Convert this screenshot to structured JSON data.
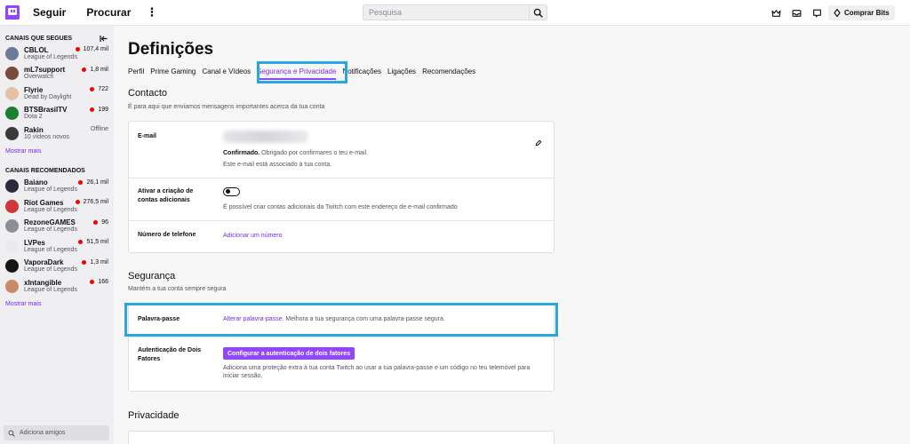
{
  "topnav": {
    "follow": "Seguir",
    "browse": "Procurar",
    "more": "⋮",
    "search_placeholder": "Pesquisa",
    "bits": "Comprar Bits"
  },
  "sidebar": {
    "followed_title": "CANAIS QUE SEGUES",
    "followed": [
      {
        "name": "CBLOL",
        "game": "League of Legends",
        "viewers": "107,4 mil",
        "live": true,
        "color": "#6b7a99"
      },
      {
        "name": "mL7support",
        "game": "Overwatch",
        "viewers": "1,8 mil",
        "live": true,
        "color": "#7a4a3a"
      },
      {
        "name": "Flyrie",
        "game": "Dead by Daylight",
        "viewers": "722",
        "live": true,
        "color": "#e4c2a8"
      },
      {
        "name": "BTSBrasilTV",
        "game": "Dota 2",
        "viewers": "199",
        "live": true,
        "color": "#1a7f2e"
      },
      {
        "name": "Rakin",
        "game": "10 vídeos novos",
        "viewers": "Offline",
        "live": false,
        "color": "#3a3a3a"
      }
    ],
    "show_more": "Mostrar mais",
    "recommended_title": "CANAIS RECOMENDADOS",
    "recommended": [
      {
        "name": "Baiano",
        "game": "League of Legends",
        "viewers": "26,1 mil",
        "live": true,
        "color": "#2a2a3a"
      },
      {
        "name": "Riot Games",
        "game": "League of Legends",
        "viewers": "276,5 mil",
        "live": true,
        "color": "#d13639"
      },
      {
        "name": "RezoneGAMES",
        "game": "League of Legends",
        "viewers": "96",
        "live": true,
        "color": "#8a8f98"
      },
      {
        "name": "LVPes",
        "game": "League of Legends",
        "viewers": "51,5 mil",
        "live": true,
        "color": "#e8eaf0"
      },
      {
        "name": "VaporaDark",
        "game": "League of Legends",
        "viewers": "1,3 mil",
        "live": true,
        "color": "#141414"
      },
      {
        "name": "xIntangible",
        "game": "League of Legends",
        "viewers": "166",
        "live": true,
        "color": "#c98a6b"
      }
    ],
    "show_more_rec": "Mostrar mais",
    "add_friends": "Adiciona amigos"
  },
  "settings": {
    "title": "Definições",
    "tabs": [
      "Perfil",
      "Prime Gaming",
      "Canal e Vídeos",
      "Segurança e Privacidade",
      "Notificações",
      "Ligações",
      "Recomendações"
    ],
    "active_tab": 3,
    "contact": {
      "title": "Contacto",
      "subtitle": "É para aqui que enviamos mensagens importantes acerca da tua conta",
      "email_label": "E-mail",
      "email_confirmed_strong": "Confirmado.",
      "email_confirmed_rest": " Obrigado por confirmares o teu e-mail.",
      "email_associated": "Este e-mail está associado à tua conta.",
      "additional_label": "Ativar a criação de contas adicionais",
      "additional_desc": "É possível criar contas adicionais da Twitch com este endereço de e-mail confirmado",
      "phone_label": "Número de telefone",
      "phone_link": "Adicionar um número"
    },
    "security": {
      "title": "Segurança",
      "subtitle": "Mantém a tua conta sempre segura",
      "password_label": "Palavra-passe",
      "password_link": "Alterar palavra-passe.",
      "password_desc": " Melhora a tua segurança com uma palavra-passe segura.",
      "twofa_label": "Autenticação de Dois Fatores",
      "twofa_button": "Configurar a autenticação de dois fatores",
      "twofa_desc": "Adiciona uma proteção extra à tua conta Twitch ao usar a tua palavra-passe e um código no teu telemóvel para iniciar sessão."
    },
    "privacy": {
      "title": "Privacidade"
    }
  },
  "colors": {
    "accent": "#9147ff",
    "link": "#772ce8",
    "highlight": "#29a7df",
    "live": "#eb0400"
  }
}
